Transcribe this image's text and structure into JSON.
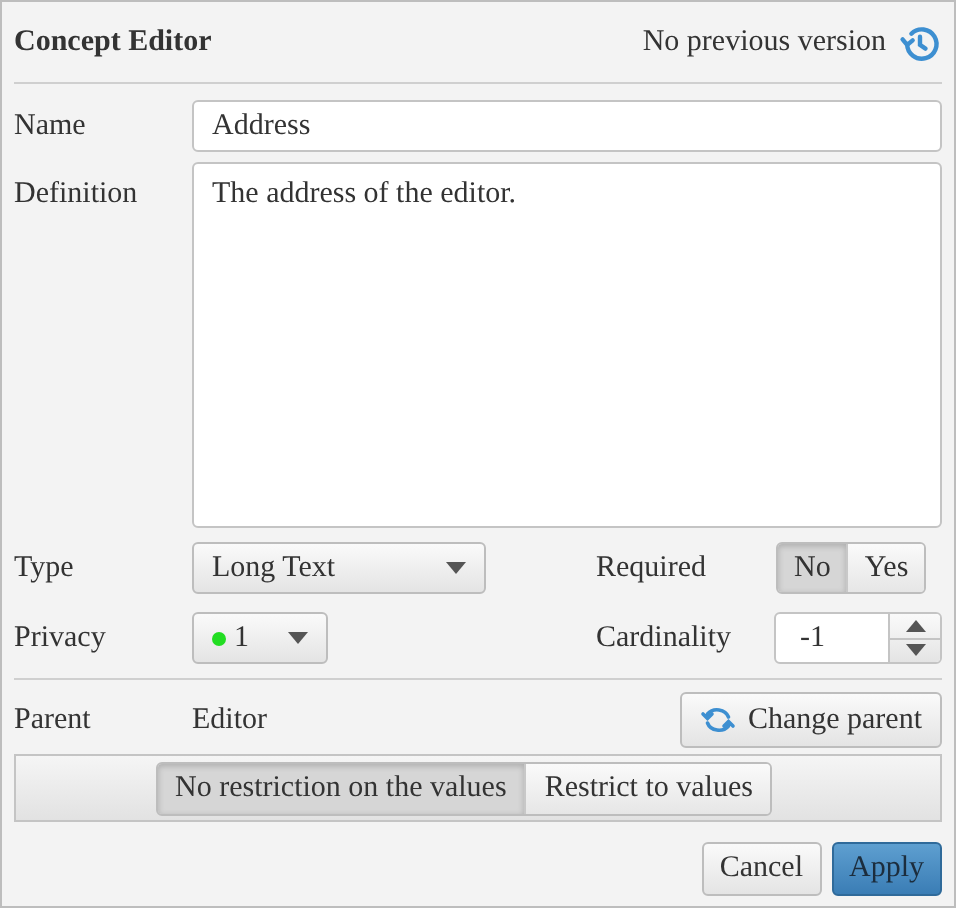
{
  "header": {
    "title": "Concept Editor",
    "version_status": "No previous version"
  },
  "name": {
    "label": "Name",
    "value": "Address"
  },
  "definition": {
    "label": "Definition",
    "value": "The address of the editor."
  },
  "type": {
    "label": "Type",
    "value": "Long Text"
  },
  "required": {
    "label": "Required",
    "options": [
      {
        "label": "No",
        "selected": true
      },
      {
        "label": "Yes",
        "selected": false
      }
    ]
  },
  "privacy": {
    "label": "Privacy",
    "value": "1",
    "color": "#22dd22"
  },
  "cardinality": {
    "label": "Cardinality",
    "value": "-1"
  },
  "parent": {
    "label": "Parent",
    "value": "Editor",
    "button": "Change parent"
  },
  "restriction": [
    {
      "label": "No restriction on the values",
      "selected": true
    },
    {
      "label": "Restrict to values",
      "selected": false
    }
  ],
  "buttons": [
    {
      "label": "Cancel",
      "kind": "default"
    },
    {
      "label": "Apply",
      "kind": "primary"
    }
  ]
}
